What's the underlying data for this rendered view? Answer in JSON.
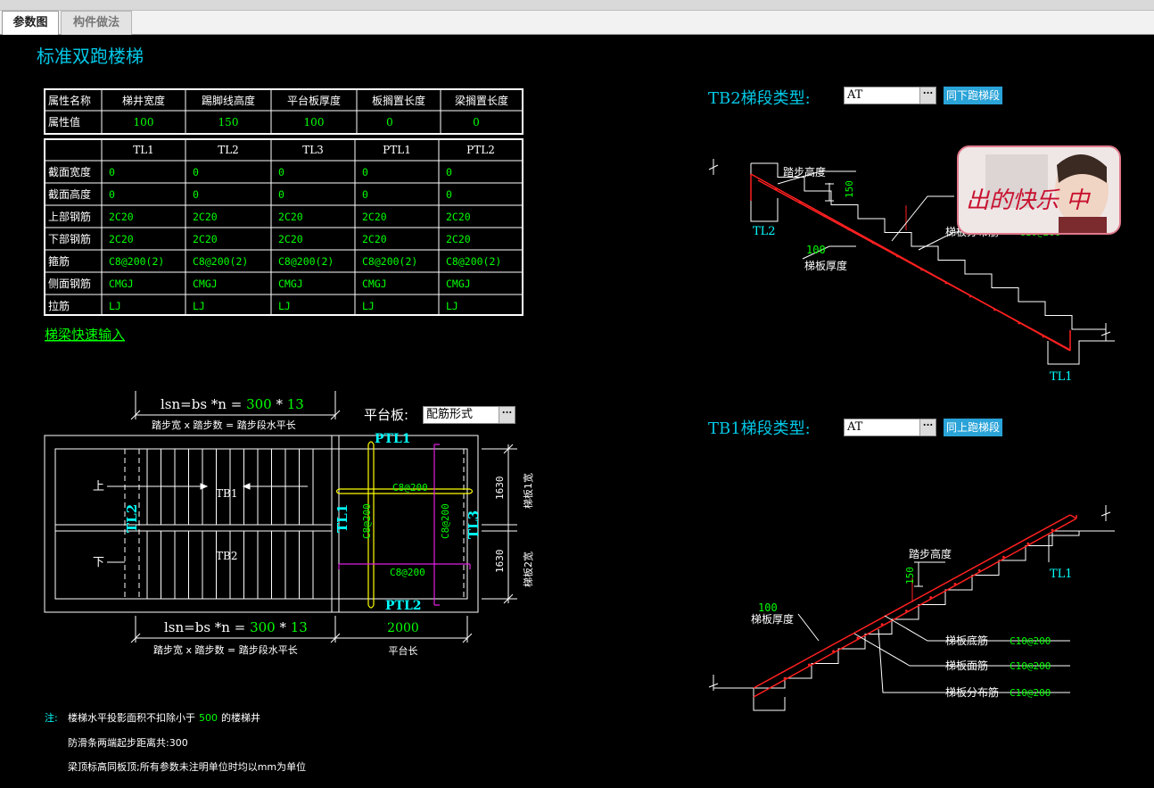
{
  "tabs": [
    {
      "label": "参数图"
    },
    {
      "label": "构件做法"
    }
  ],
  "title": "标准双跑楼梯",
  "prop_table": {
    "row_header": "属性名称",
    "value_header": "属性值",
    "names": [
      "梯井宽度",
      "踢脚线高度",
      "平台板厚度",
      "板搁置长度",
      "梁搁置长度"
    ],
    "values": [
      "100",
      "150",
      "100",
      "0",
      "0"
    ]
  },
  "beam_table": {
    "columns": [
      "TL1",
      "TL2",
      "TL3",
      "PTL1",
      "PTL2"
    ],
    "rows": [
      {
        "label": "截面宽度",
        "cells": [
          "0",
          "0",
          "0",
          "0",
          "0"
        ]
      },
      {
        "label": "截面高度",
        "cells": [
          "0",
          "0",
          "0",
          "0",
          "0"
        ]
      },
      {
        "label": "上部钢筋",
        "cells": [
          "2C20",
          "2C20",
          "2C20",
          "2C20",
          "2C20"
        ]
      },
      {
        "label": "下部钢筋",
        "cells": [
          "2C20",
          "2C20",
          "2C20",
          "2C20",
          "2C20"
        ]
      },
      {
        "label": "箍筋",
        "cells": [
          "C8@200(2)",
          "C8@200(2)",
          "C8@200(2)",
          "C8@200(2)",
          "C8@200(2)"
        ]
      },
      {
        "label": "侧面钢筋",
        "cells": [
          "CMGJ",
          "CMGJ",
          "CMGJ",
          "CMGJ",
          "CMGJ"
        ]
      },
      {
        "label": "拉筋",
        "cells": [
          "LJ",
          "LJ",
          "LJ",
          "LJ",
          "LJ"
        ]
      }
    ]
  },
  "quick_input_link": "梯梁快速输入",
  "plan": {
    "top_dim": {
      "formula": "lsn=bs *n = ",
      "bs": "300",
      "sep": " * ",
      "n": "13",
      "caption": "踏步宽 x 踏步数 = 踏步段水平长"
    },
    "bottom_dim": {
      "formula": "lsn=bs *n = ",
      "bs": "300",
      "sep": " * ",
      "n": "13",
      "caption": "踏步宽 x 踏步数 = 踏步段水平长"
    },
    "platform_label": "平台板:",
    "platform_value": "配筋形式",
    "platform_len": "2000",
    "platform_len_caption": "平台长",
    "up": "上",
    "down": "下",
    "tb1": "TB1",
    "tb2": "TB2",
    "tl1": "TL1",
    "tl2": "TL2",
    "tl3": "TL3",
    "ptl1": "PTL1",
    "ptl2": "PTL2",
    "rebar_top": "C8@200",
    "rebar_bottom": "C8@200",
    "rebar_left_v": "C8@200",
    "rebar_right_v": "C8@200",
    "w1": "1630",
    "w1_caption": "梯板1宽",
    "w2": "1630",
    "w2_caption": "梯板2宽"
  },
  "notes": {
    "prefix": "注:",
    "line1_a": "楼梯水平投影面积不扣除小于",
    "line1_num": "500",
    "line1_b": "的楼梯井",
    "line2": "防滑条两端起步距离共:300",
    "line3": "梁顶标高同板顶;所有参数未注明单位时均以mm为单位"
  },
  "tb2": {
    "title": "TB2梯段类型:",
    "type_value": "AT",
    "link": "同下跑梯段",
    "step_height_label": "踏步高度",
    "step_height": "150",
    "thickness": "100",
    "thickness_label": "梯板厚度",
    "tl2": "TL2",
    "tl1": "TL1",
    "dist_label": "梯板分布筋",
    "dist_value": "C10@200"
  },
  "tb1": {
    "title": "TB1梯段类型:",
    "type_value": "AT",
    "link": "同上跑梯段",
    "step_height_label": "踏步高度",
    "step_height": "150",
    "thickness": "100",
    "thickness_label": "梯板厚度",
    "tl1": "TL1",
    "bottom_rebar_label": "梯板底筋",
    "bottom_rebar": "C10@200",
    "top_rebar_label": "梯板面筋",
    "top_rebar": "C10@200",
    "dist_label": "梯板分布筋",
    "dist_value": "C10@200"
  },
  "avatar_text": "出的快乐 中",
  "colors": {
    "title_cyan": "#00c8e6",
    "value_green": "#00ff00",
    "rebar_red": "#ff2020",
    "yellow": "#ffff00",
    "magenta": "#e020e0",
    "cyan_label": "#00ffff"
  }
}
